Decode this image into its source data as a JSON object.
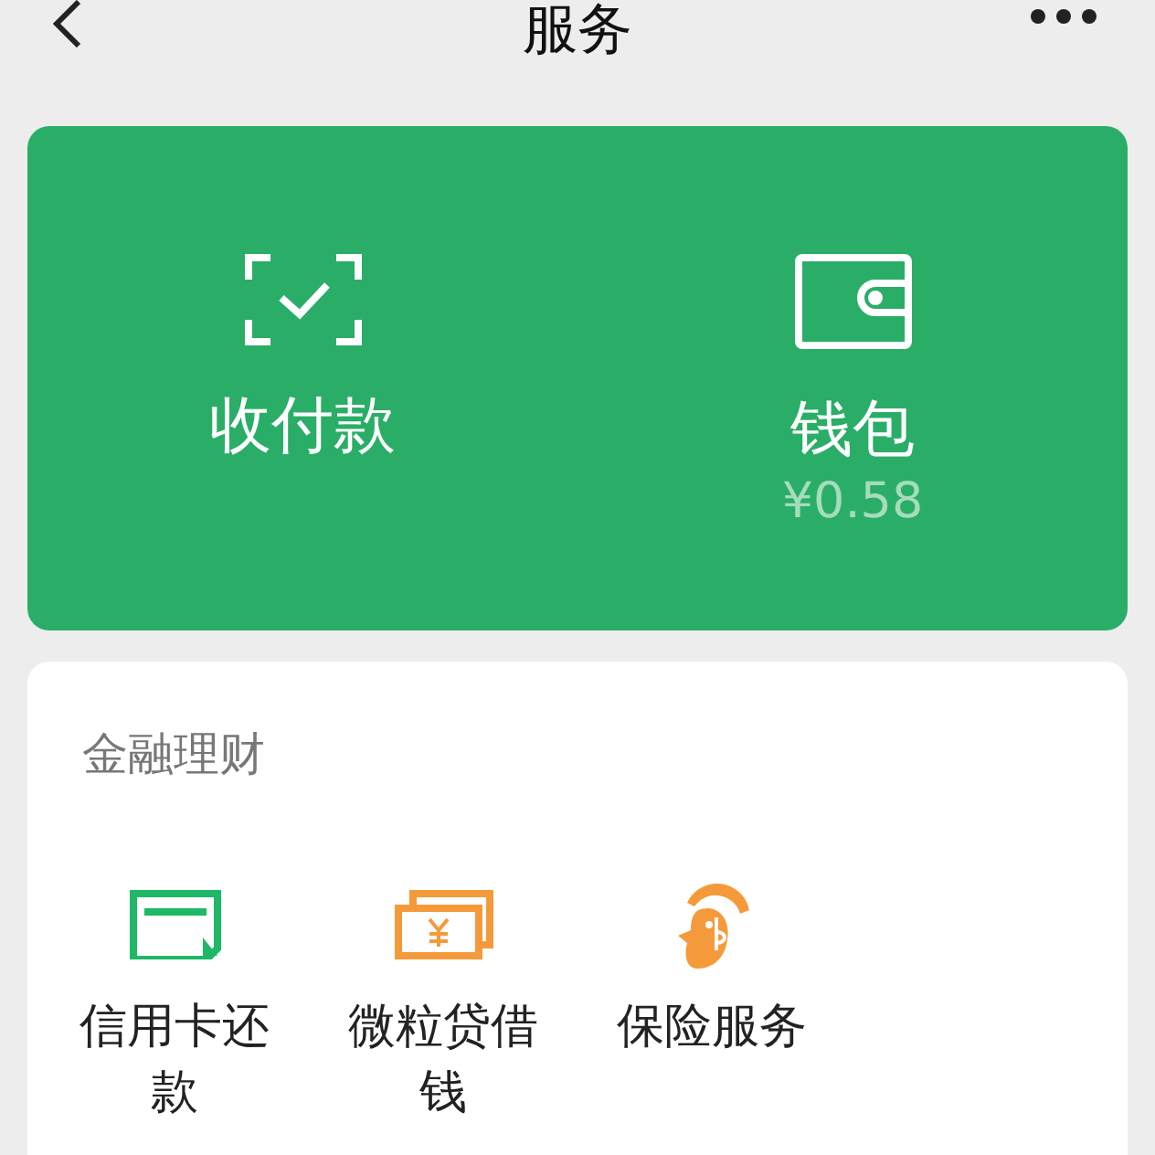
{
  "header": {
    "title": "服务"
  },
  "wallet_card": {
    "items": [
      {
        "kind": "pay",
        "label": "收付款"
      },
      {
        "kind": "wallet",
        "label": "钱包",
        "balance": "¥0.58"
      }
    ]
  },
  "finance": {
    "title": "金融理财",
    "items": [
      {
        "kind": "card",
        "label": "信用卡还款"
      },
      {
        "kind": "loan",
        "label": "微粒贷借钱"
      },
      {
        "kind": "insurance",
        "label": "保险服务"
      }
    ]
  }
}
